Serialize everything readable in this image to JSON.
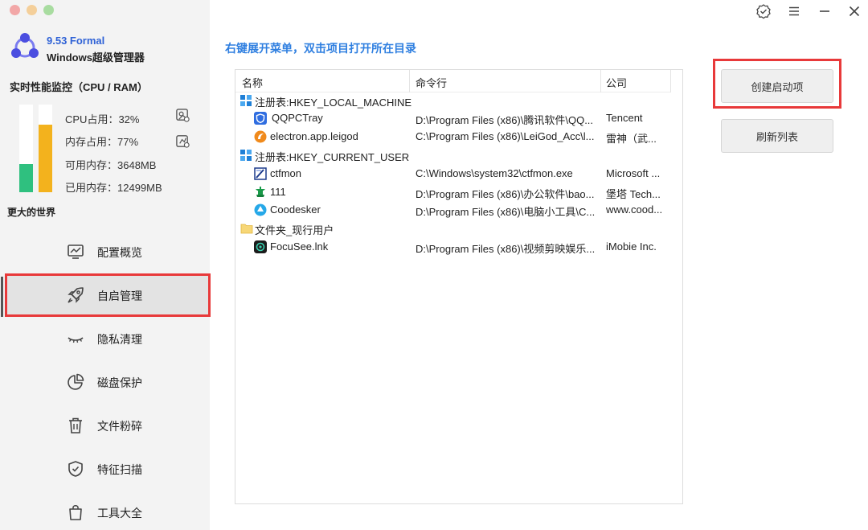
{
  "app": {
    "version": "9.53 Formal",
    "name": "Windows超级管理器"
  },
  "monitor": {
    "title": "实时性能监控（CPU / RAM）",
    "cpu_percent": 32,
    "mem_percent": 77,
    "cpu_label": "CPU占用：32%",
    "mem_label": "内存占用：77%",
    "avail_label": "可用内存：3648MB",
    "used_label": "已用内存：12499MB",
    "cpu_color": "#2fc07f",
    "mem_color": "#f3b21d"
  },
  "section_title": "更大的世界",
  "nav": [
    {
      "label": "配置概览",
      "icon": "monitor-chart-icon"
    },
    {
      "label": "自启管理",
      "icon": "rocket-icon",
      "active": true
    },
    {
      "label": "隐私清理",
      "icon": "closed-eye-icon"
    },
    {
      "label": "磁盘保护",
      "icon": "pie-chart-icon"
    },
    {
      "label": "文件粉碎",
      "icon": "trash-icon"
    },
    {
      "label": "特征扫描",
      "icon": "shield-check-icon"
    },
    {
      "label": "工具大全",
      "icon": "bag-icon"
    }
  ],
  "hint": "右键展开菜单，双击项目打开所在目录",
  "table": {
    "headers": [
      "名称",
      "命令行",
      "公司"
    ],
    "rows": [
      {
        "type": "group",
        "name": "注册表:HKEY_LOCAL_MACHINE",
        "icon": "registry-icon"
      },
      {
        "type": "item",
        "name": "QQPCTray",
        "cmd": "D:\\Program Files (x86)\\腾讯软件\\QQ...",
        "company": "Tencent",
        "icon": "qq-pc-manager-icon"
      },
      {
        "type": "item",
        "name": "electron.app.leigod",
        "cmd": "C:\\Program Files (x86)\\LeiGod_Acc\\l...",
        "company": "雷神（武...",
        "icon": "leigod-icon"
      },
      {
        "type": "group",
        "name": "注册表:HKEY_CURRENT_USER",
        "icon": "registry-icon"
      },
      {
        "type": "item",
        "name": "ctfmon",
        "cmd": "C:\\Windows\\system32\\ctfmon.exe",
        "company": "Microsoft ...",
        "icon": "ctfmon-icon"
      },
      {
        "type": "item",
        "name": "111",
        "cmd": "D:\\Program Files (x86)\\办公软件\\bao...",
        "company": "堡塔 Tech...",
        "icon": "baota-icon"
      },
      {
        "type": "item",
        "name": "Coodesker",
        "cmd": "D:\\Program Files (x86)\\电脑小工具\\C...",
        "company": "www.cood...",
        "icon": "coodesker-icon"
      },
      {
        "type": "group",
        "name": "文件夹_现行用户",
        "icon": "folder-icon"
      },
      {
        "type": "item",
        "name": "FocuSee.lnk",
        "cmd": "D:\\Program Files (x86)\\视频剪映娱乐...",
        "company": "iMobie Inc.",
        "icon": "focusee-icon"
      }
    ]
  },
  "buttons": {
    "create": "创建启动项",
    "refresh": "刷新列表"
  },
  "colors": {
    "accent_blue": "#2f7fe0",
    "highlight_red": "#e8393a"
  }
}
